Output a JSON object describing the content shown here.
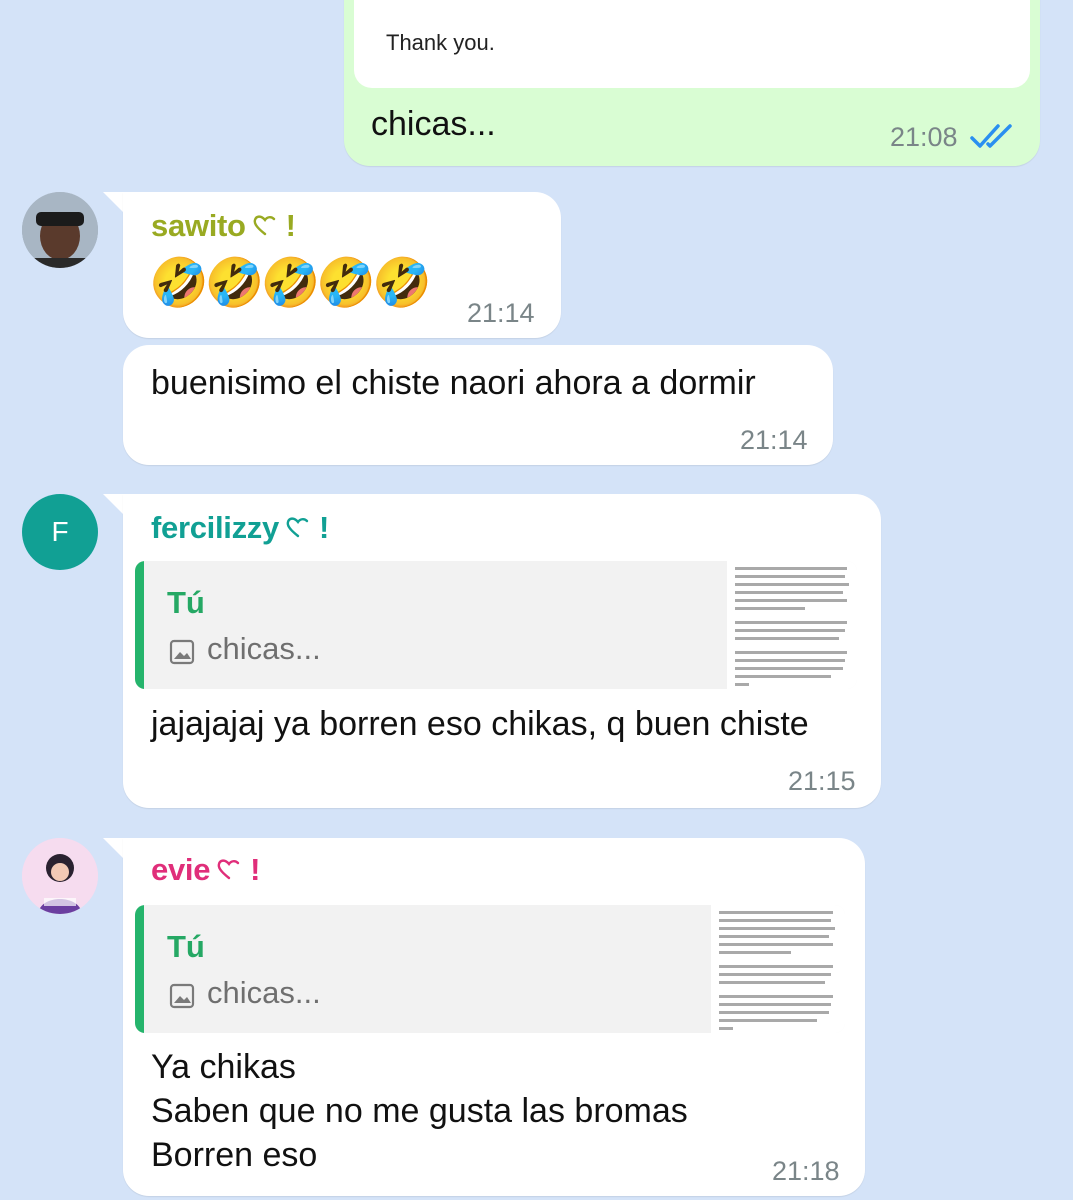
{
  "messages": {
    "outgoing": {
      "card_text": "Thank you.",
      "text": "chicas...",
      "time": "21:08",
      "status_icon": "double-check-read-icon"
    },
    "sawito": {
      "sender": "sawito",
      "sender_suffix": "!",
      "sender_color": "#99aa22",
      "emojis": "🤣🤣🤣🤣🤣",
      "time1": "21:14",
      "text2": "buenisimo el chiste naori ahora a dormir",
      "time2": "21:14"
    },
    "fercilizzy": {
      "sender": "fercilizzy",
      "sender_suffix": "!",
      "sender_color": "#11a094",
      "avatar_letter": "F",
      "quote_author": "Tú",
      "quote_text": "chicas...",
      "text": "jajajajaj ya borren eso chikas, q buen chiste",
      "time": "21:15"
    },
    "evie": {
      "sender": "evie",
      "sender_suffix": "!",
      "sender_color": "#e02e7a",
      "quote_author": "Tú",
      "quote_text": "chicas...",
      "lines": [
        "Ya chikas",
        "Saben que no me gusta las bromas",
        "Borren eso"
      ],
      "time": "21:18"
    }
  }
}
